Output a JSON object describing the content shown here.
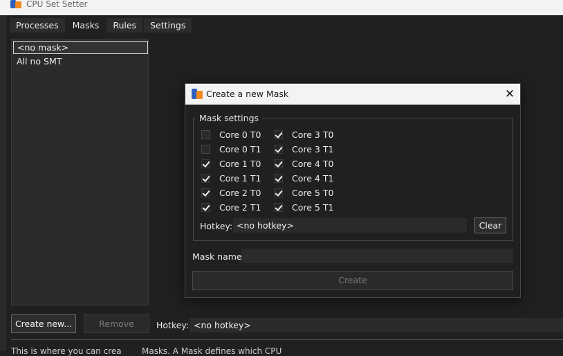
{
  "app": {
    "title": "CPU Set Setter"
  },
  "tabs": [
    {
      "label": "Processes"
    },
    {
      "label": "Masks"
    },
    {
      "label": "Rules"
    },
    {
      "label": "Settings"
    }
  ],
  "active_tab": "Masks",
  "mask_list": {
    "items": [
      {
        "label": "<no mask>",
        "selected": true
      },
      {
        "label": "All no SMT",
        "selected": false
      }
    ]
  },
  "buttons": {
    "create_new": "Create new...",
    "remove": "Remove"
  },
  "hotkey": {
    "label": "Hotkey:",
    "value": "<no hotkey>"
  },
  "dialog": {
    "title": "Create a new Mask",
    "close_glyph": "✕",
    "group_title": "Mask settings",
    "cores": [
      {
        "label": "Core 0 T0",
        "checked": false
      },
      {
        "label": "Core 0 T1",
        "checked": false
      },
      {
        "label": "Core 1 T0",
        "checked": true
      },
      {
        "label": "Core 1 T1",
        "checked": true
      },
      {
        "label": "Core 2 T0",
        "checked": true
      },
      {
        "label": "Core 2 T1",
        "checked": true
      },
      {
        "label": "Core 3 T0",
        "checked": true
      },
      {
        "label": "Core 3 T1",
        "checked": true
      },
      {
        "label": "Core 4 T0",
        "checked": true
      },
      {
        "label": "Core 4 T1",
        "checked": true
      },
      {
        "label": "Core 5 T0",
        "checked": true
      },
      {
        "label": "Core 5 T1",
        "checked": true
      }
    ],
    "hotkey_label": "Hotkey:",
    "hotkey_value": "<no hotkey>",
    "clear_label": "Clear",
    "mask_name_label": "Mask name:",
    "mask_name_value": "",
    "create_label": "Create"
  },
  "bottom": {
    "text_left": "This is where you can crea",
    "text_right": "Masks. A Mask defines which CPU"
  },
  "colors": {
    "background": "#202020",
    "panel": "#2b2b2b",
    "titlebar": "#f3f3f3",
    "disabled_text": "#7a7a7a"
  }
}
